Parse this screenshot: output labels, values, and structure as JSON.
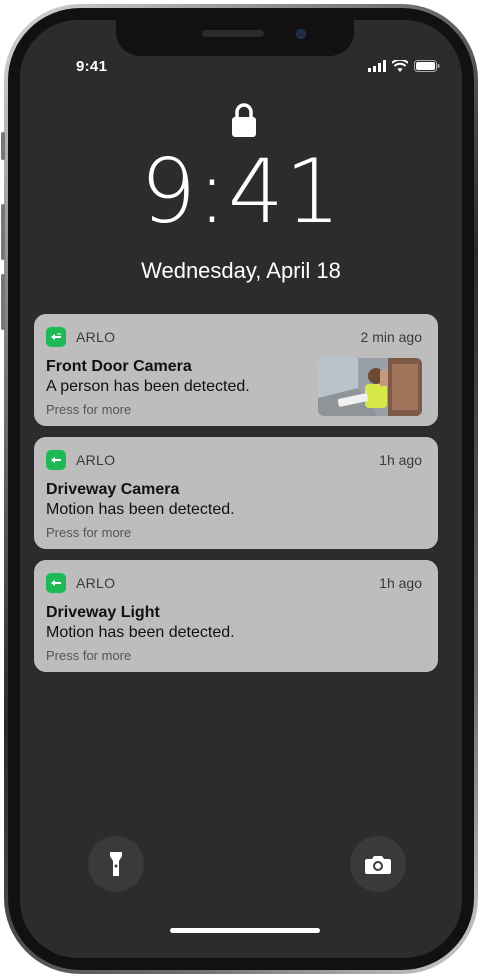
{
  "status_bar": {
    "time": "9:41"
  },
  "lockscreen": {
    "time": "9:41",
    "date": "Wednesday, April 18"
  },
  "notifications": [
    {
      "app": "ARLO",
      "time": "2 min ago",
      "title": "Front Door Camera",
      "body": "A person has been detected.",
      "more": "Press for more",
      "has_thumbnail": true
    },
    {
      "app": "ARLO",
      "time": "1h ago",
      "title": "Driveway Camera",
      "body": "Motion has been detected.",
      "more": "Press for more",
      "has_thumbnail": false
    },
    {
      "app": "ARLO",
      "time": "1h ago",
      "title": "Driveway Light",
      "body": "Motion has been detected.",
      "more": "Press for more",
      "has_thumbnail": false
    }
  ],
  "quick_actions": {
    "left_icon": "flashlight-icon",
    "right_icon": "camera-icon"
  },
  "colors": {
    "app_icon": "#1db954",
    "notification_bg": "#bdbdbd",
    "screen_bg": "#2c2c2e"
  }
}
